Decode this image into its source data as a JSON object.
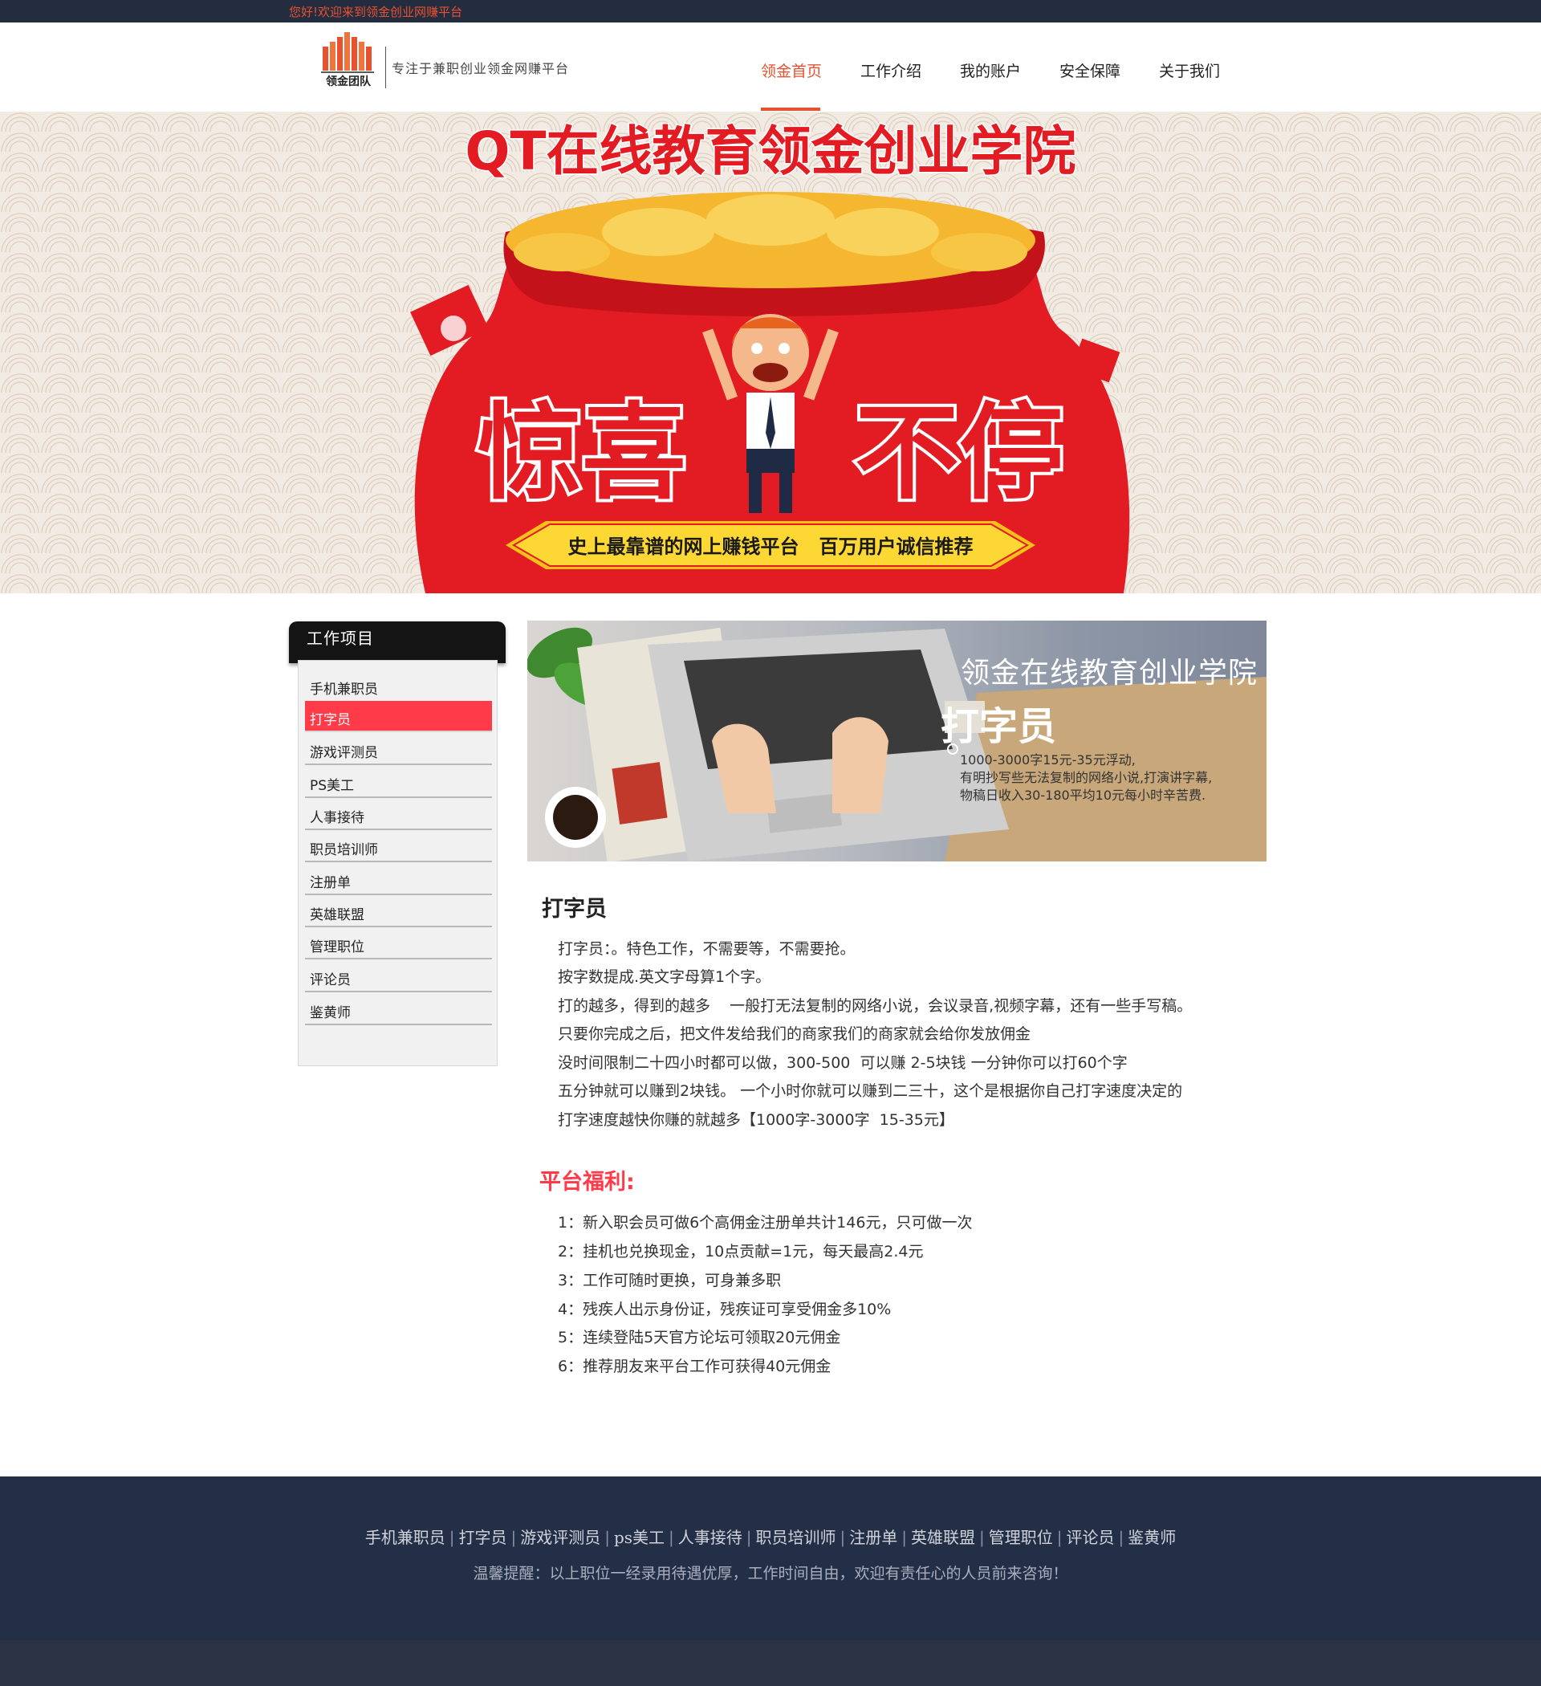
{
  "topbar": {
    "welcome": "您好!欢迎来到领金创业网赚平台"
  },
  "header": {
    "logo_text": "领金团队",
    "slogan": "专注于兼职创业领金网赚平台",
    "nav": [
      "领金首页",
      "工作介绍",
      "我的账户",
      "安全保障",
      "关于我们"
    ],
    "active_index": 0
  },
  "hero": {
    "title": "QT在线教育领金创业学院",
    "big_left": "惊喜",
    "big_right": "不停",
    "ribbon": "史上最靠谱的网上赚钱平台   百万用户诚信推荐"
  },
  "sidebar": {
    "title": "工作项目",
    "items": [
      "手机兼职员",
      "打字员",
      "游戏评测员",
      "PS美工",
      "人事接待",
      "职员培训师",
      "注册单",
      "英雄联盟",
      "管理职位",
      "评论员",
      "鉴黄师"
    ],
    "active_index": 1
  },
  "feature": {
    "title": "领金在线教育创业学院",
    "subtitle": "打字员",
    "desc": [
      "1000-3000字15元-35元浮动,",
      "有明抄写些无法复制的网络小说,打演讲字幕,",
      "物稿日收入30-180平均10元每小时辛苦费."
    ]
  },
  "content": {
    "title": "打字员",
    "paragraphs": [
      "打字员：。特色工作，不需要等，不需要抢。",
      "按字数提成.英文字母算1个字。",
      "打的越多，得到的越多    一般打无法复制的网络小说，会议录音,视频字幕，还有一些手写稿。",
      "只要你完成之后，把文件发给我们的商家我们的商家就会给你发放佣金",
      "没时间限制二十四小时都可以做，300-500  可以赚 2-5块钱 一分钟你可以打60个字",
      "五分钟就可以赚到2块钱。 一个小时你就可以赚到二三十，这个是根据你自己打字速度决定的",
      "打字速度越快你赚的就越多【1000字-3000字  15-35元】"
    ],
    "benefit_title": "平台福利:",
    "benefits": [
      "1：新入职会员可做6个高佣金注册单共计146元，只可做一次",
      "2：挂机也兑换现金，10点贡献=1元，每天最高2.4元",
      "3：工作可随时更换，可身兼多职",
      "4：残疾人出示身份证，残疾证可享受佣金多10%",
      "5：连续登陆5天官方论坛可领取20元佣金",
      "6：推荐朋友来平台工作可获得40元佣金"
    ]
  },
  "footer": {
    "links": [
      "手机兼职员",
      "打字员",
      "游戏评测员",
      "ps美工",
      "人事接待",
      "职员培训师",
      "注册单",
      "英雄联盟",
      "管理职位",
      "评论员",
      "鉴黄师"
    ],
    "note": "温馨提醒：以上职位一经录用待遇优厚，工作时间自由，欢迎有责任心的人员前来咨询！"
  },
  "colors": {
    "accent": "#e8512f",
    "highlight": "#ff3a49",
    "topbar_bg": "#242d40",
    "footer_bg": "#232e47"
  }
}
